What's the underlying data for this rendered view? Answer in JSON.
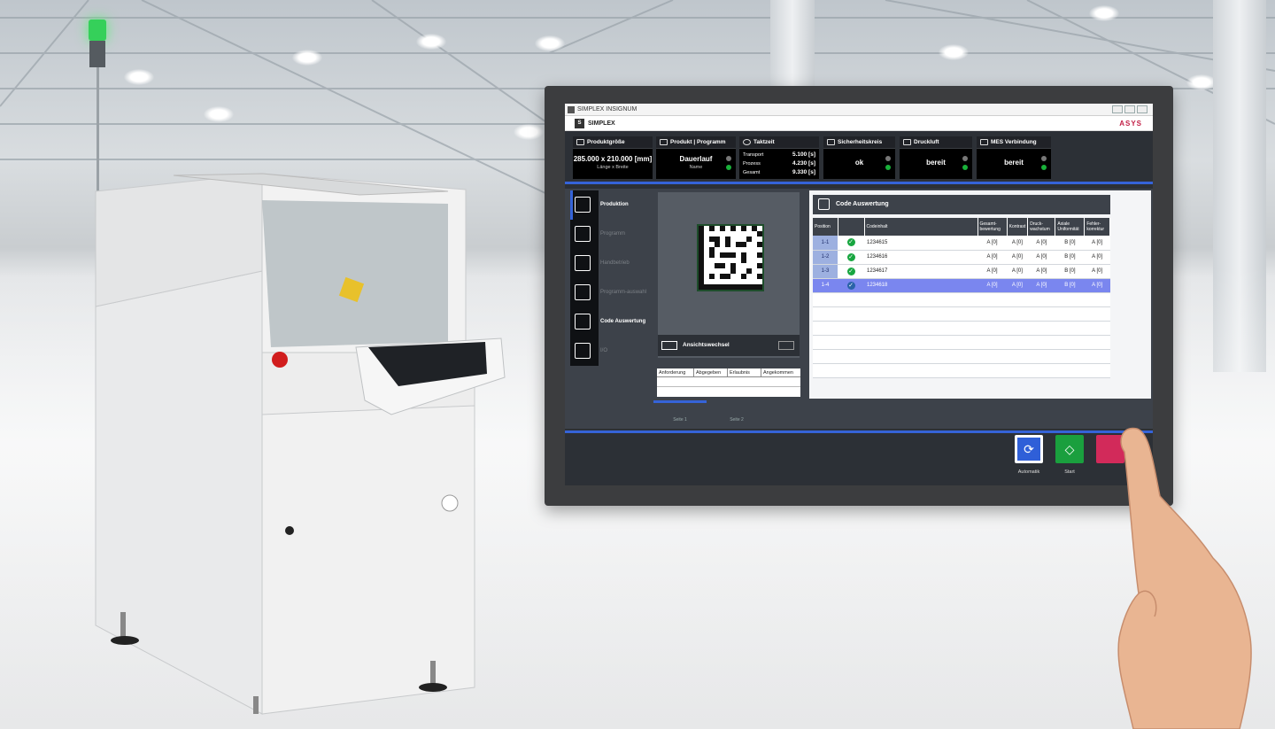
{
  "window": {
    "title": "SIMPLEX INSIGNUM",
    "app_name": "SIMPLEX",
    "brand": "ASYS"
  },
  "status_tiles": {
    "produktgroesse": {
      "label": "Produktgröße",
      "value": "285.000 x 210.000 [mm]",
      "sub": "Länge x Breite"
    },
    "programm": {
      "label": "Produkt | Programm",
      "value": "Dauerlauf",
      "sub": "Name"
    },
    "taktzeit": {
      "label": "Taktzeit",
      "rows": [
        {
          "name": "Transport",
          "value": "5.100 [s]"
        },
        {
          "name": "Prozess",
          "value": "4.230 [s]"
        },
        {
          "name": "Gesamt",
          "value": "9.330 [s]"
        }
      ]
    },
    "sicherheitskreis": {
      "label": "Sicherheitskreis",
      "value": "ok"
    },
    "druckluft": {
      "label": "Druckluft",
      "value": "bereit"
    },
    "mes": {
      "label": "MES Verbindung",
      "value": "bereit"
    }
  },
  "nav": {
    "items": [
      {
        "label": "Produktion",
        "icon": "gears-icon",
        "active": true
      },
      {
        "label": "Programm",
        "icon": "document-icon",
        "active": false
      },
      {
        "label": "Handbetrieb",
        "icon": "hand-icon",
        "active": false
      },
      {
        "label": "Programm-auswahl",
        "icon": "list-icon",
        "active": false
      },
      {
        "label": "Code Auswertung",
        "icon": "magnifier-icon",
        "active": false
      },
      {
        "label": "I/O",
        "icon": "io-icon",
        "active": false
      }
    ]
  },
  "preview": {
    "switch_label": "Ansichtswechsel"
  },
  "queue": {
    "headers": [
      "Anforderung",
      "Abgegeben",
      "Erlaubnis",
      "Angekommen"
    ]
  },
  "pages": [
    "Seite 1",
    "Seite 2"
  ],
  "code_panel": {
    "title": "Code Auswertung",
    "headers": [
      "Position",
      "",
      "Codeinhalt",
      "Gesamt-bewertung",
      "Kontrast",
      "Druck-wachstum",
      "Axiale Uniformität",
      "Fehler-korrektur"
    ],
    "rows": [
      {
        "position": "1-1",
        "code": "1234615",
        "gesamt": "A [0]",
        "kontrast": "A [0]",
        "druck": "A [0]",
        "axial": "B [0]",
        "fehler": "A [0]",
        "selected": false
      },
      {
        "position": "1-2",
        "code": "1234616",
        "gesamt": "A [0]",
        "kontrast": "A [0]",
        "druck": "A [0]",
        "axial": "B [0]",
        "fehler": "A [0]",
        "selected": false
      },
      {
        "position": "1-3",
        "code": "1234617",
        "gesamt": "A [0]",
        "kontrast": "A [0]",
        "druck": "A [0]",
        "axial": "B [0]",
        "fehler": "A [0]",
        "selected": false
      },
      {
        "position": "1-4",
        "code": "1234618",
        "gesamt": "A [0]",
        "kontrast": "A [0]",
        "druck": "A [0]",
        "axial": "B [0]",
        "fehler": "A [0]",
        "selected": true
      }
    ]
  },
  "bottom_buttons": {
    "automatik": "Automatik",
    "start": "Start"
  },
  "colors": {
    "accent": "#3563d8",
    "ok": "#18a640",
    "brand": "#c21f46",
    "stop": "#d22a5a"
  }
}
